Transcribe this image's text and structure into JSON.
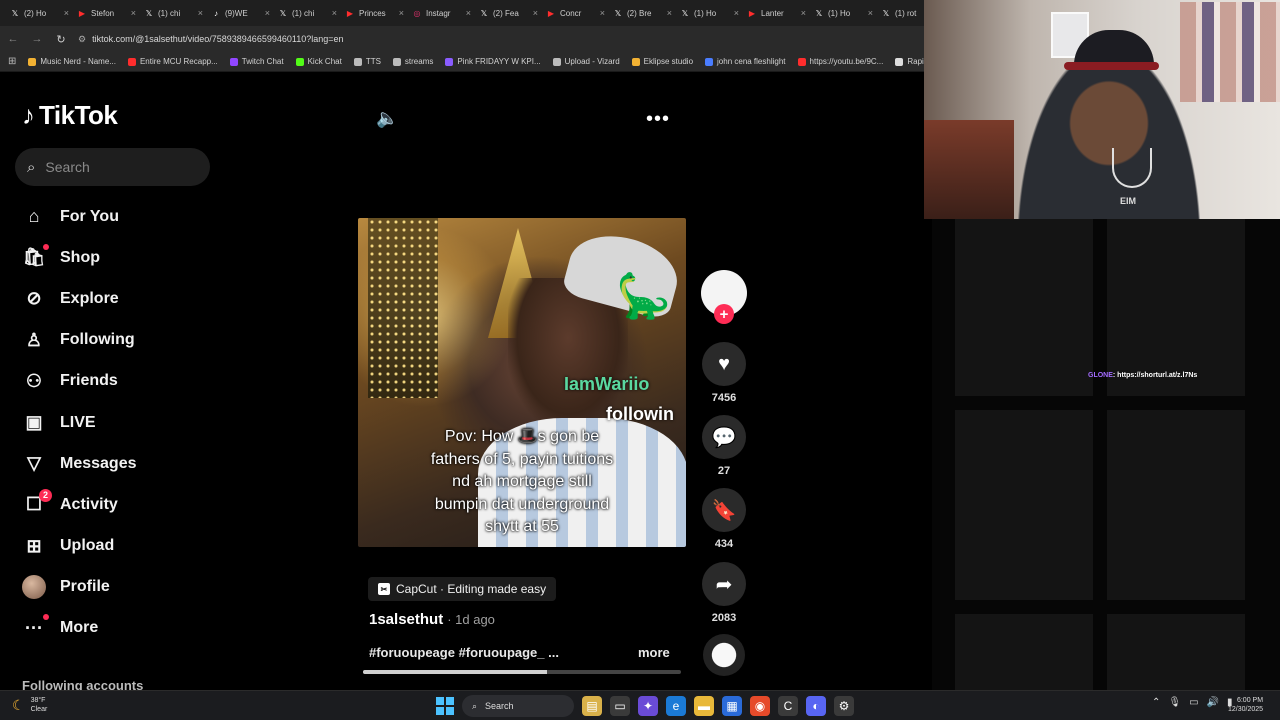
{
  "browser": {
    "tabs": [
      {
        "icon": "x",
        "label": "(2) Ho"
      },
      {
        "icon": "red",
        "label": "Stefon"
      },
      {
        "icon": "x",
        "label": "(1) chi"
      },
      {
        "icon": "tiktok",
        "label": "(9)WE"
      },
      {
        "icon": "x",
        "label": "(1) chi"
      },
      {
        "icon": "red",
        "label": "Princes"
      },
      {
        "icon": "ig",
        "label": "Instagr"
      },
      {
        "icon": "x",
        "label": "(2) Fea"
      },
      {
        "icon": "red",
        "label": "Concr"
      },
      {
        "icon": "x",
        "label": "(2) Bre"
      },
      {
        "icon": "x",
        "label": "(1) Ho"
      },
      {
        "icon": "red",
        "label": "Lanter"
      },
      {
        "icon": "x",
        "label": "(1) Ho"
      },
      {
        "icon": "x",
        "label": "(1) rot"
      }
    ],
    "url": "tiktok.com/@1salsethut/video/7589389466599460110?lang=en",
    "bookmarks": [
      {
        "label": "Music Nerd - Name...",
        "color": "#f2b233"
      },
      {
        "label": "Entire MCU Recapp...",
        "color": "#ff2d2d"
      },
      {
        "label": "Twitch Chat",
        "color": "#9146ff"
      },
      {
        "label": "Kick Chat",
        "color": "#53fc18"
      },
      {
        "label": "TTS",
        "color": "#bbbbbb"
      },
      {
        "label": "streams",
        "color": "#bbbbbb"
      },
      {
        "label": "Pink FRIDAYY W KPI...",
        "color": "#8a5cff"
      },
      {
        "label": "Upload - Vizard",
        "color": "#bbbbbb"
      },
      {
        "label": "Eklipse studio",
        "color": "#f2b233"
      },
      {
        "label": "john cena fleshlight",
        "color": "#4a7dff"
      },
      {
        "label": "https://youtu.be/9C...",
        "color": "#ff2d2d"
      },
      {
        "label": "Rapidtags | You",
        "color": "#dddddd"
      }
    ]
  },
  "sidebar": {
    "logo": "TikTok",
    "search_placeholder": "Search",
    "items": [
      {
        "label": "For You",
        "icon": "home-icon",
        "glyph": "⌂"
      },
      {
        "label": "Shop",
        "icon": "shop-bag-icon",
        "glyph": "🛍",
        "dot": true
      },
      {
        "label": "Explore",
        "icon": "compass-icon",
        "glyph": "⊘"
      },
      {
        "label": "Following",
        "icon": "following-person-icon",
        "glyph": "♙"
      },
      {
        "label": "Friends",
        "icon": "friends-icon",
        "glyph": "⚇"
      },
      {
        "label": "LIVE",
        "icon": "live-tv-icon",
        "glyph": "▣"
      },
      {
        "label": "Messages",
        "icon": "paper-plane-icon",
        "glyph": "▽"
      },
      {
        "label": "Activity",
        "icon": "activity-inbox-icon",
        "glyph": "☐",
        "badge": "2"
      },
      {
        "label": "Upload",
        "icon": "plus-square-icon",
        "glyph": "⊞"
      },
      {
        "label": "Profile",
        "icon": "profile-avatar",
        "glyph": ""
      },
      {
        "label": "More",
        "icon": "more-dots-icon",
        "glyph": "···",
        "dot": true
      }
    ],
    "following_accounts_header": "Following accounts"
  },
  "video": {
    "overlay_name": "IamWariio",
    "overlay_follow": "followin",
    "caption": "Pov: How 🎩s gon be\nfathers of 5, payin tuitions\nnd ah mortgage still\nbumpin dat underground\nshytt at  55",
    "capcut_label": "CapCut · Editing made easy",
    "author": "1salsethut",
    "posted": "· 1d ago",
    "tags": "#foruoupeage #foruoupage_ ...",
    "more_label": "more",
    "progress": 0.58
  },
  "actions": {
    "likes": "7456",
    "comments": "27",
    "saves": "434",
    "shares": "2083"
  },
  "stream_overlay": {
    "link_prefix": "GLONE",
    "link_text": ": https://shorturl.at/z.l7Ns",
    "shirt_text": "EIM"
  },
  "taskbar": {
    "temp": "38°F",
    "condition": "Clear",
    "search_label": "Search",
    "time": "6:00 PM",
    "date": "12/30/2025"
  }
}
